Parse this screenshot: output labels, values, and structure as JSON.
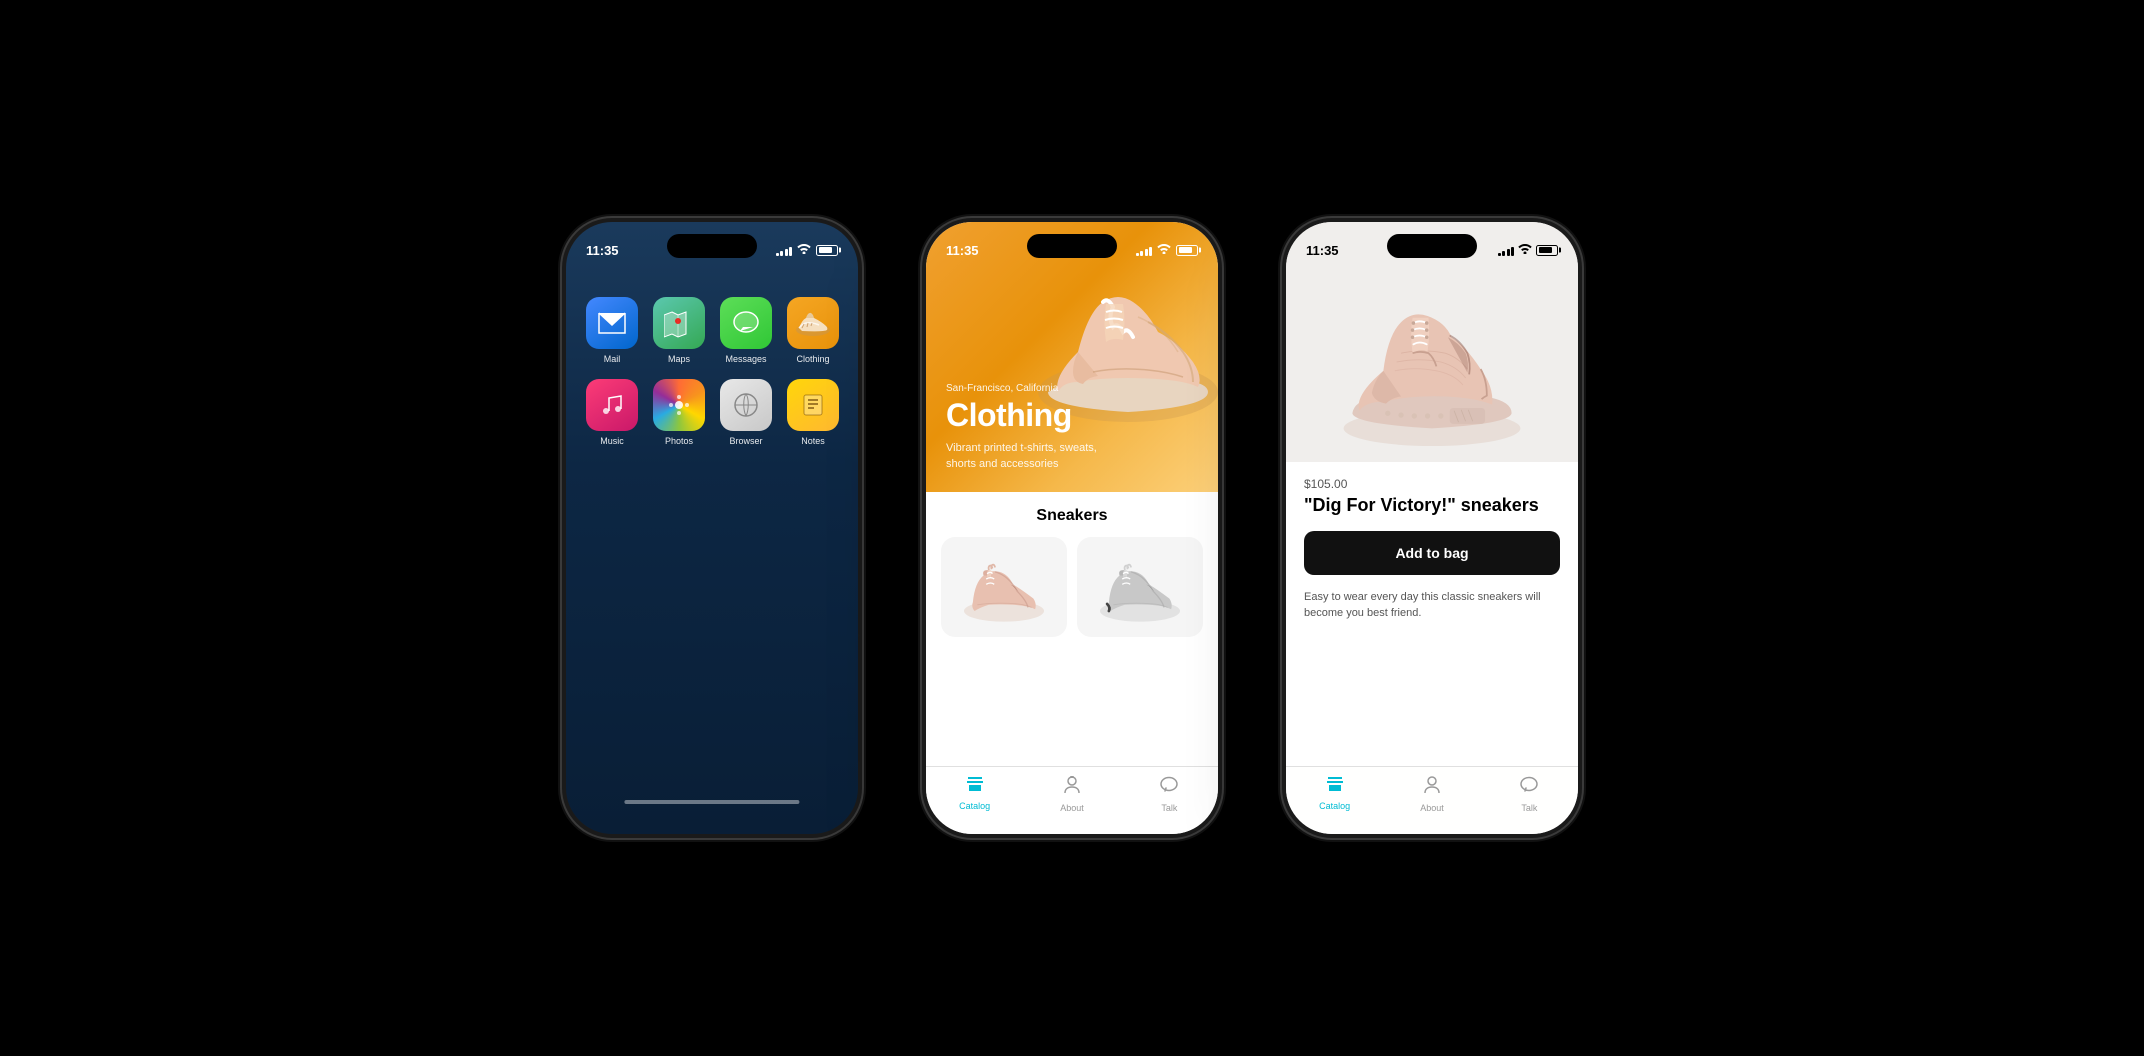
{
  "phones": {
    "phone1": {
      "status_time": "11:35",
      "apps": [
        {
          "name": "Mail",
          "icon_class": "icon-mail",
          "emoji": "✉️",
          "label": "Mail"
        },
        {
          "name": "Maps",
          "icon_class": "icon-maps",
          "emoji": "🗺️",
          "label": "Maps"
        },
        {
          "name": "Messages",
          "icon_class": "icon-messages",
          "emoji": "💬",
          "label": "Messages"
        },
        {
          "name": "Clothing",
          "icon_class": "icon-clothing",
          "emoji": "👟",
          "label": "Clothing"
        },
        {
          "name": "Music",
          "icon_class": "icon-music",
          "emoji": "🎵",
          "label": "Music"
        },
        {
          "name": "Photos",
          "icon_class": "icon-photos",
          "emoji": "🌸",
          "label": "Photos"
        },
        {
          "name": "Browser",
          "icon_class": "icon-browser",
          "emoji": "🧭",
          "label": "Browser"
        },
        {
          "name": "Notes",
          "icon_class": "icon-notes",
          "emoji": "📝",
          "label": "Notes"
        }
      ]
    },
    "phone2": {
      "status_time": "11:35",
      "hero": {
        "location": "San-Francisco, California",
        "title": "Clothing",
        "subtitle": "Vibrant printed t-shirts, sweats, shorts and accessories"
      },
      "section_title": "Sneakers",
      "tabs": [
        {
          "name": "Catalog",
          "active": true
        },
        {
          "name": "About",
          "active": false
        },
        {
          "name": "Talk",
          "active": false
        }
      ]
    },
    "phone3": {
      "status_time": "11:35",
      "product": {
        "price": "$105.00",
        "name": "\"Dig For Victory!\" sneakers",
        "add_to_bag": "Add to bag",
        "description": "Easy to wear every day this classic sneakers will become you best friend."
      },
      "tabs": [
        {
          "name": "Catalog",
          "active": true
        },
        {
          "name": "About",
          "active": false
        },
        {
          "name": "Talk",
          "active": false
        }
      ]
    }
  }
}
